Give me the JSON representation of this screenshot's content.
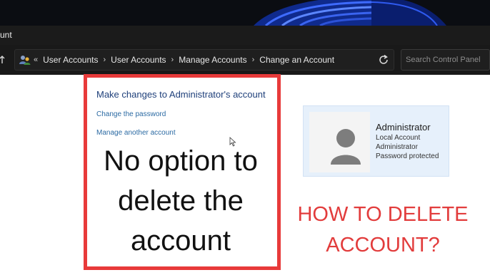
{
  "window": {
    "title": "unt"
  },
  "address_bar": {
    "overflow_chevron": "«",
    "crumbs": [
      "User Accounts",
      "User Accounts",
      "Manage Accounts",
      "Change an Account"
    ],
    "separator": "›"
  },
  "search": {
    "placeholder": "Search Control Panel"
  },
  "main": {
    "header": "Make changes to Administrator's account",
    "links": [
      "Change the password",
      "Manage another account"
    ]
  },
  "annotation": {
    "big_text_lines": [
      "No option to",
      "delete the",
      "account"
    ],
    "caption_lines": [
      "HOW TO DELETE",
      "ACCOUNT?"
    ],
    "box_color": "#e83a3a",
    "caption_color": "#e23c3c"
  },
  "account_card": {
    "name": "Administrator",
    "details": [
      "Local Account",
      "Administrator",
      "Password protected"
    ]
  },
  "icons": [
    "user-accounts-icon",
    "refresh-icon",
    "up-arrow-icon",
    "mouse-cursor-icon",
    "avatar-icon"
  ]
}
